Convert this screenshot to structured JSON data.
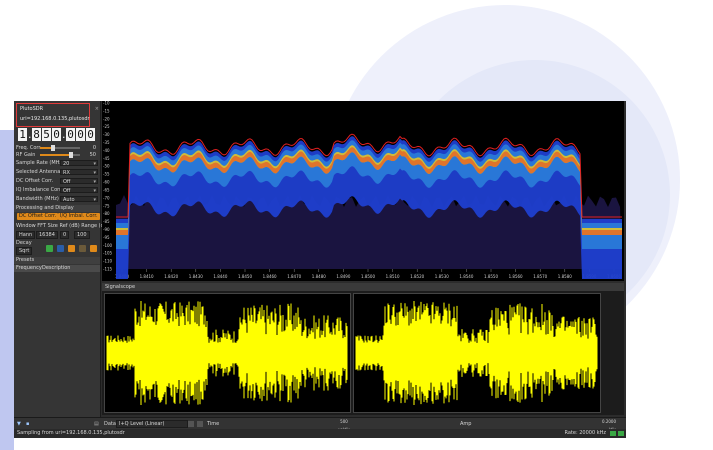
{
  "device": {
    "title": "PlutoSDR",
    "close": "×",
    "uri": "uri=192.168.0.135,plutosdr",
    "frequency_digits": [
      "1",
      ".",
      "8",
      "5",
      "0",
      ".",
      "0",
      "0",
      "0"
    ]
  },
  "settings": {
    "freq_corr": {
      "label": "Freq. Corr.",
      "value": "0"
    },
    "rf_gain": {
      "label": "RF Gain",
      "value": "50"
    },
    "rows": [
      {
        "label": "Sample Rate (MHz)",
        "value": "20"
      },
      {
        "label": "Selected Antenna",
        "value": "RX"
      },
      {
        "label": "DC Offset Corr.",
        "value": "Off"
      },
      {
        "label": "IQ Imbalance Corr.",
        "value": "Off"
      },
      {
        "label": "Bandwidth (MHz)",
        "value": "Auto"
      }
    ]
  },
  "processing": {
    "header": "Processing and Display",
    "dc_btn": "DC Offset Corr.",
    "iq_btn": "I/Q Imbal. Corr.",
    "fft_label": "Window FFT Size Ref (dB) Range (dB)",
    "fields": [
      "Hann",
      "16384",
      "0",
      "100"
    ],
    "decay_label": "Decay",
    "decay_value": "Sqrt"
  },
  "presets": {
    "header": "Presets",
    "col_frequency": "Frequency",
    "col_description": "Description"
  },
  "spectrum": {
    "y_ticks": [
      "-10",
      "-15",
      "-20",
      "-25",
      "-30",
      "-35",
      "-40",
      "-45",
      "-50",
      "-55",
      "-60",
      "-65",
      "-70",
      "-75",
      "-80",
      "-85",
      "-90",
      "-95",
      "-100",
      "-105",
      "-110",
      "-115"
    ],
    "x_ticks": [
      "1.8400",
      "1.8410",
      "1.8420",
      "1.8430",
      "1.8440",
      "1.8450",
      "1.8460",
      "1.8470",
      "1.8480",
      "1.8490",
      "1.8500",
      "1.8510",
      "1.8520",
      "1.8530",
      "1.8540",
      "1.8550",
      "1.8560",
      "1.8570",
      "1.8580",
      "1.8590",
      "1.8600"
    ]
  },
  "scope": {
    "header": "Signalscope",
    "data_label": "Data",
    "data_value": "I+Q Level (Linear)",
    "time_label": "Time",
    "time_div": "500",
    "time_unit": "µs/div",
    "amp_label": "Amp",
    "amp_div": "0.2000",
    "amp_unit": "/div"
  },
  "status": {
    "left": "Sampling from uri=192.168.0.135,plutosdr",
    "right": "Rate: 20000 kHz"
  },
  "colors": {
    "accent": "#e08a1a",
    "signal": "#ffff00",
    "highlight": "#e03a3a"
  }
}
